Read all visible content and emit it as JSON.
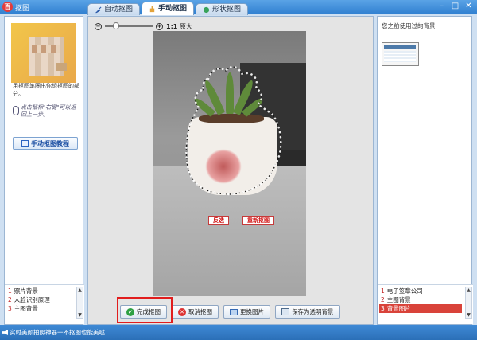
{
  "window": {
    "title": "抠图",
    "app_icon": "百"
  },
  "tabs": [
    {
      "label": "自动抠图",
      "icon": "brush-icon"
    },
    {
      "label": "手动抠图",
      "icon": "hand-icon"
    },
    {
      "label": "形状抠图",
      "icon": "shape-icon"
    }
  ],
  "left": {
    "hint": "用抠图笔圈出你想抠图的部分。",
    "mouse_hint": "点击鼠标\"右键\"可以返回上一步。",
    "tutorial_label": "手动抠图教程",
    "library": [
      {
        "num": "1",
        "label": "照片背景"
      },
      {
        "num": "2",
        "label": "人脸识别原理"
      },
      {
        "num": "3",
        "label": "主图背景"
      }
    ]
  },
  "center": {
    "zoom": {
      "ratio": "1:1",
      "label": "原大",
      "level": 0.2
    },
    "photo_buttons": {
      "invert": "反选",
      "redraw": "重新抠图"
    },
    "buttons": {
      "finish": "完成抠图",
      "cancel": "取消抠图",
      "replace": "更换图片",
      "save_transparent": "保存为透明背景"
    }
  },
  "right": {
    "recent_label": "您之前使用过的背景",
    "library": [
      {
        "num": "1",
        "label": "电子签章公司"
      },
      {
        "num": "2",
        "label": "主图背景"
      },
      {
        "num": "3",
        "label": "背景图片",
        "selected": true
      }
    ]
  },
  "status": {
    "text": "实时美颜拍照神器一不抠图也能美哒"
  },
  "colors": {
    "accent": "#2f7fd0",
    "highlight": "#e11d1d",
    "selected": "#d9433a"
  }
}
